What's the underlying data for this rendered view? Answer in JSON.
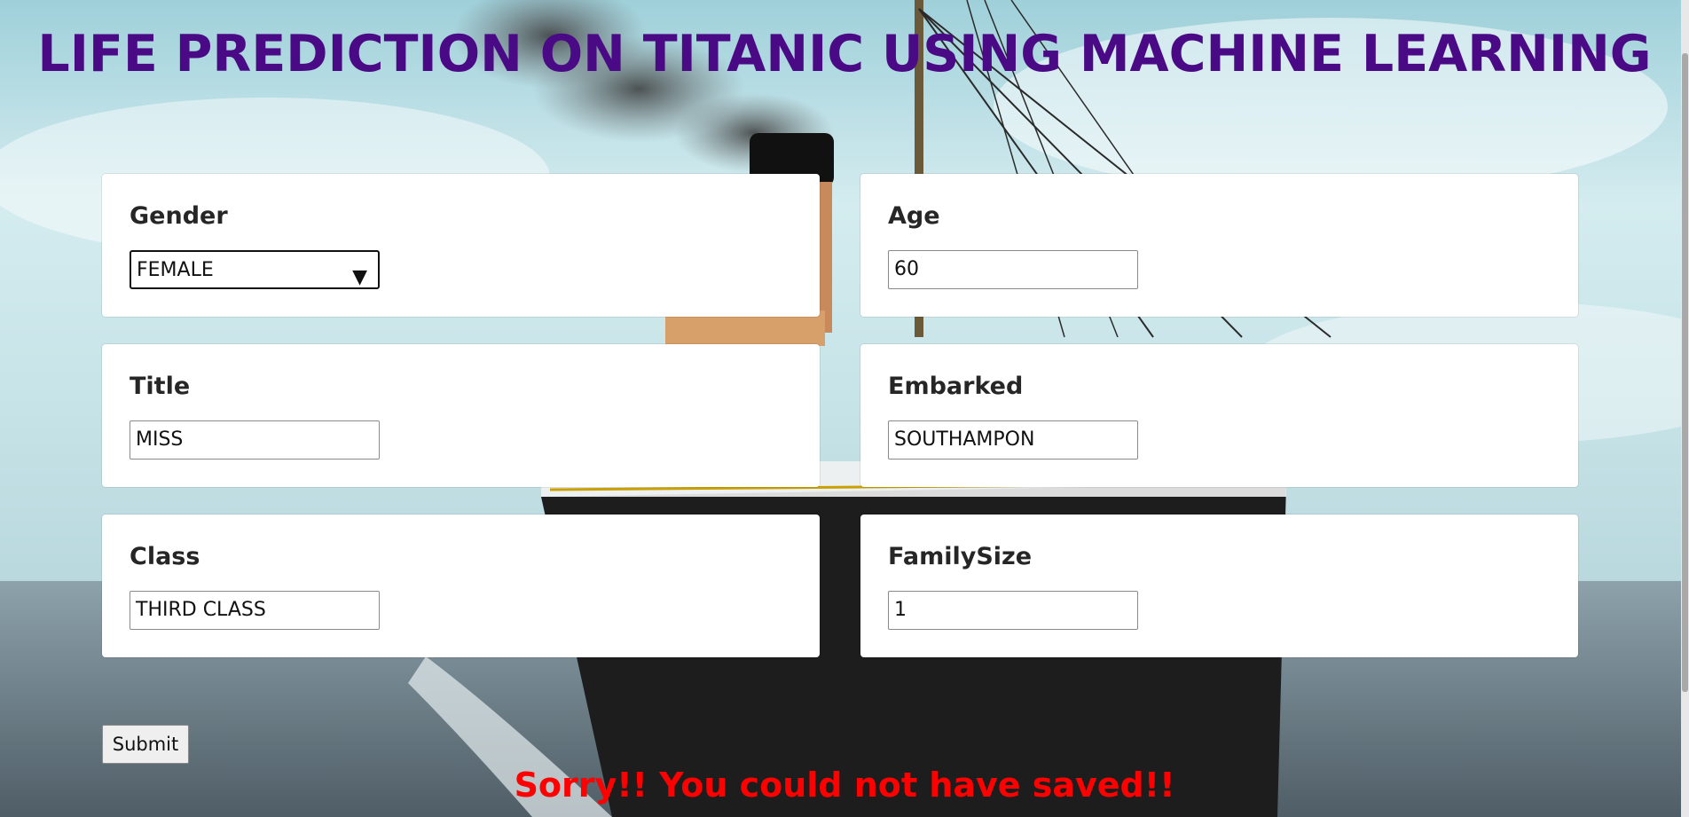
{
  "page": {
    "title": "LIFE PREDICTION ON TITANIC USING MACHINE LEARNING",
    "result_message": "Sorry!! You could not have saved!!",
    "submit_label": "Submit"
  },
  "form": {
    "gender": {
      "label": "Gender",
      "value": "FEMALE"
    },
    "age": {
      "label": "Age",
      "value": "60"
    },
    "title": {
      "label": "Title",
      "value": "MISS"
    },
    "embarked": {
      "label": "Embarked",
      "value": "SOUTHAMPON"
    },
    "class": {
      "label": "Class",
      "value": "THIRD CLASS"
    },
    "family_size": {
      "label": "FamilySize",
      "value": "1"
    }
  },
  "colors": {
    "title": "#4b0a85",
    "result": "#ff0000"
  }
}
